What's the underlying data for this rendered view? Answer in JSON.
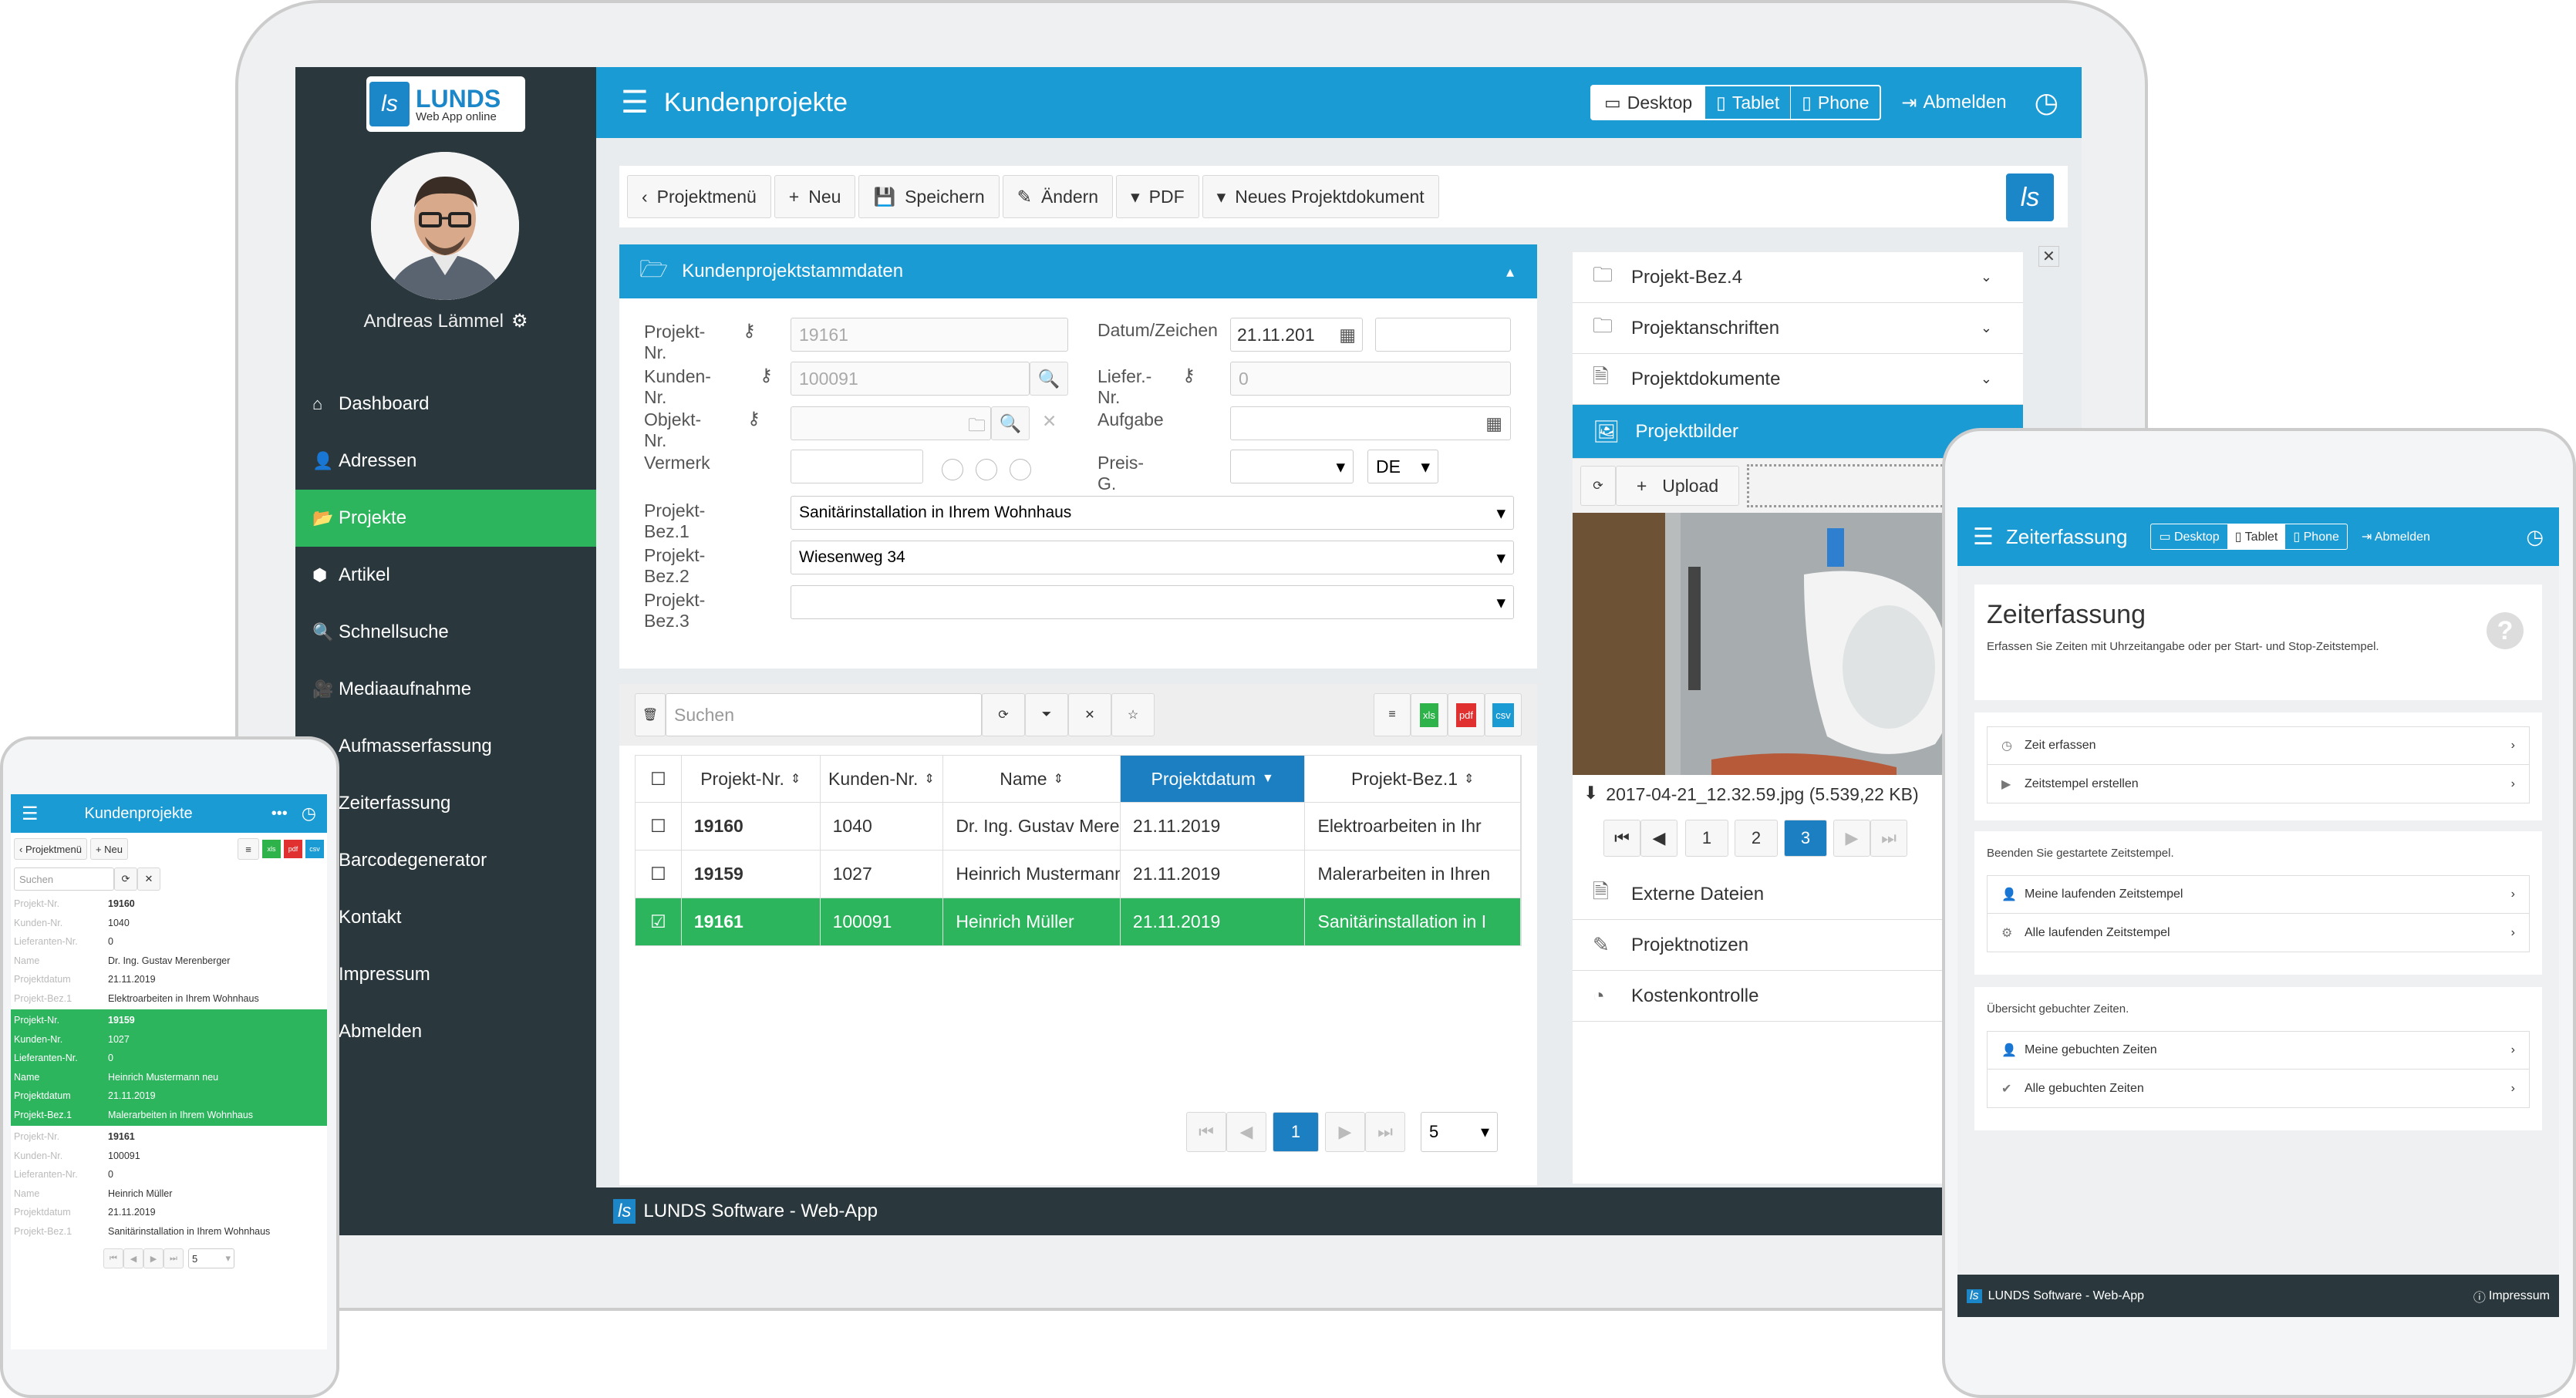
{
  "desktop": {
    "header_title": "Kundenprojekte",
    "view_buttons": [
      "Desktop",
      "Tablet",
      "Phone"
    ],
    "logout": "Abmelden",
    "logo_main": "LUNDS",
    "logo_sub": "Web App online",
    "user_name": "Andreas Lämmel",
    "nav": [
      "Dashboard",
      "Adressen",
      "Projekte",
      "Artikel",
      "Schnellsuche",
      "Mediaaufnahme",
      "Aufmasserfassung",
      "Zeiterfassung",
      "Barcodegenerator",
      "Kontakt",
      "Impressum",
      "Abmelden"
    ],
    "nav_active": "Projekte",
    "toolbar": [
      "Projektmenü",
      "Neu",
      "Speichern",
      "Ändern",
      "PDF",
      "Neues Projektdokument"
    ],
    "panel_title": "Kundenprojektstammdaten",
    "form": {
      "projekt_nr_label": "Projekt-Nr.",
      "projekt_nr_value": "19161",
      "datum_label": "Datum/Zeichen",
      "datum_value": "21.11.201",
      "kunden_nr_label": "Kunden-Nr.",
      "kunden_nr_value": "100091",
      "liefer_nr_label": "Liefer.-Nr.",
      "liefer_nr_value": "0",
      "objekt_nr_label": "Objekt-Nr.",
      "aufgabe_label": "Aufgabe",
      "vermerk_label": "Vermerk",
      "preis_label": "Preis-G.",
      "lang_value": "DE",
      "bez1_label": "Projekt-Bez.1",
      "bez1_value": "Sanitärinstallation in Ihrem Wohnhaus",
      "bez2_label": "Projekt-Bez.2",
      "bez2_value": "Wiesenweg 34",
      "bez3_label": "Projekt-Bez.3",
      "bez3_value": ""
    },
    "search_placeholder": "Suchen",
    "export": [
      "xls",
      "pdf",
      "csv"
    ],
    "table": {
      "headers": [
        "Projekt-Nr.",
        "Kunden-Nr.",
        "Name",
        "Projektdatum",
        "Projekt-Bez.1"
      ],
      "rows": [
        [
          "19160",
          "1040",
          "Dr. Ing. Gustav Mere",
          "21.11.2019",
          "Elektroarbeiten in Ihr"
        ],
        [
          "19159",
          "1027",
          "Heinrich Mustermann",
          "21.11.2019",
          "Malerarbeiten in Ihren"
        ],
        [
          "19161",
          "100091",
          "Heinrich Müller",
          "21.11.2019",
          "Sanitärinstallation in I"
        ]
      ],
      "selected_row": 2
    },
    "pager": {
      "page": "1",
      "size": "5"
    },
    "right": {
      "items_top": [
        "Projekt-Bez.4",
        "Projektanschriften",
        "Projektdokumente"
      ],
      "active": "Projektbilder",
      "upload": "Upload",
      "file": "2017-04-21_12.32.59.jpg (5.539,22 KB)",
      "pages": [
        "1",
        "2",
        "3"
      ],
      "page_active": "3",
      "items_bottom": [
        "Externe Dateien",
        "Projektnotizen",
        "Kostenkontrolle"
      ]
    },
    "footer": "LUNDS Software - Web-App"
  },
  "phone": {
    "title": "Kundenprojekte",
    "btns": [
      "Projektmenü",
      "Neu"
    ],
    "search_placeholder": "Suchen",
    "export": [
      "xls",
      "pdf",
      "csv"
    ],
    "field_labels": [
      "Projekt-Nr.",
      "Kunden-Nr.",
      "Lieferanten-Nr.",
      "Name",
      "Projektdatum",
      "Projekt-Bez.1"
    ],
    "records": [
      [
        "19160",
        "1040",
        "0",
        "Dr. Ing. Gustav Merenberger",
        "21.11.2019",
        "Elektroarbeiten in Ihrem Wohnhaus"
      ],
      [
        "19159",
        "1027",
        "0",
        "Heinrich Mustermann neu",
        "21.11.2019",
        "Malerarbeiten in Ihrem Wohnhaus"
      ],
      [
        "19161",
        "100091",
        "0",
        "Heinrich Müller",
        "21.11.2019",
        "Sanitärinstallation in Ihrem Wohnhaus"
      ]
    ],
    "page_size": "5"
  },
  "tablet": {
    "title": "Zeiterfassung",
    "view_buttons": [
      "Desktop",
      "Tablet",
      "Phone"
    ],
    "logout": "Abmelden",
    "heading": "Zeiterfassung",
    "desc": "Erfassen Sie Zeiten mit Uhrzeitangabe oder per Start- und Stop-Zeitstempel.",
    "group1": [
      "Zeit erfassen",
      "Zeitstempel erstellen"
    ],
    "group2_title": "Beenden Sie gestartete Zeitstempel.",
    "group2": [
      "Meine laufenden Zeitstempel",
      "Alle laufenden Zeitstempel"
    ],
    "group3_title": "Übersicht gebuchter Zeiten.",
    "group3": [
      "Meine gebuchten Zeiten",
      "Alle gebuchten Zeiten"
    ],
    "footer": "LUNDS Software - Web-App",
    "impressum": "Impressum"
  }
}
